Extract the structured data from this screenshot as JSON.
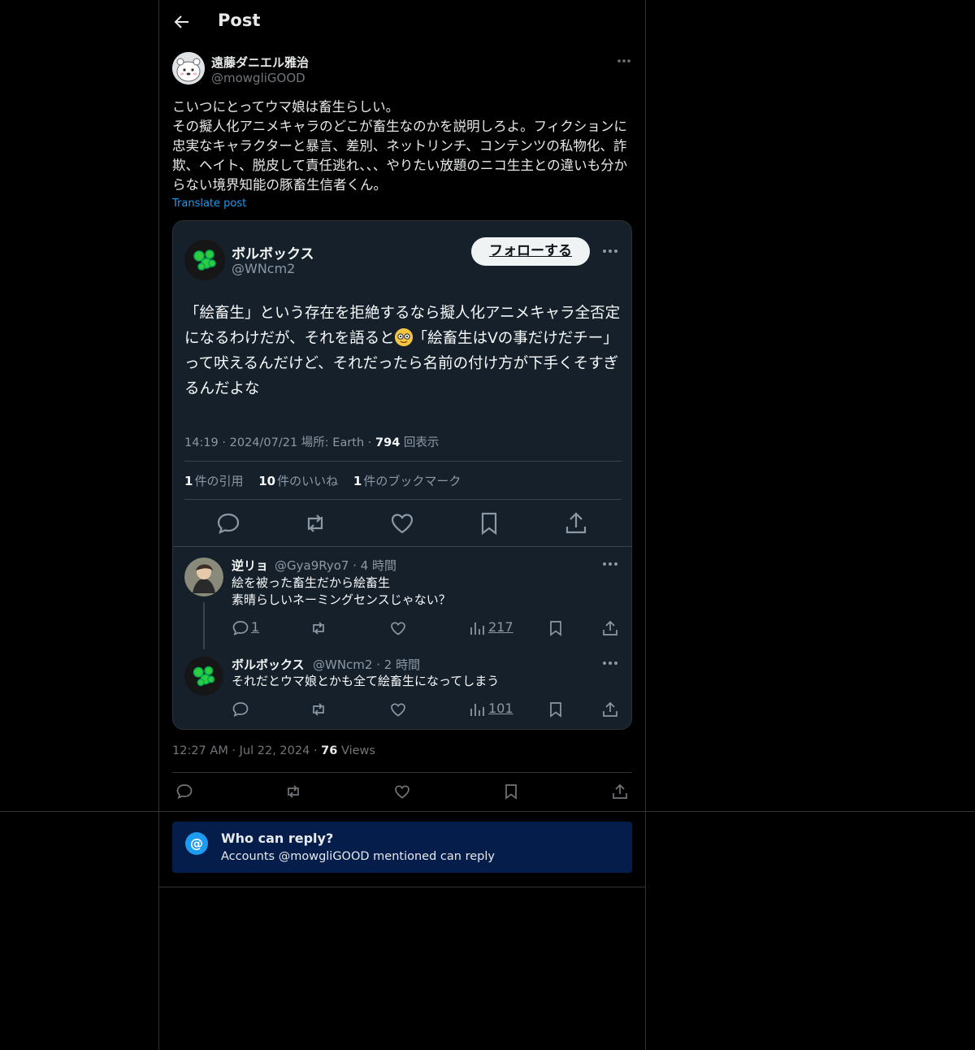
{
  "header": {
    "title": "Post",
    "back_icon": "arrow-left-icon"
  },
  "author": {
    "name": "遠藤ダニエル雅治",
    "handle": "@mowgliGOOD"
  },
  "post": {
    "text": "こいつにとってウマ娘は畜生らしい。\nその擬人化アニメキャラのどこが畜生なのかを説明しろよ。フィクションに忠実なキャラクターと暴言、差別、ネットリンチ、コンテンツの私物化、詐欺、ヘイト、脱皮して責任逃れ、、、やりたい放題のニコ生主との違いも分からない境界知能の豚畜生信者くん。",
    "translate_label": "Translate post",
    "time": "12:27 AM",
    "date": "Jul 22, 2024",
    "views_count": "76",
    "views_label": "Views"
  },
  "embed": {
    "name": "ボルボックス",
    "handle": "@WNcm2",
    "follow_label": "フォローする",
    "text_before_emoji": "「絵畜生」という存在を拒絶するなら擬人化アニメキャラ全否定になるわけだが、それを語ると",
    "text_after_emoji": "「絵畜生はVの事だけだチー」って吠えるんだけど、それだったら名前の付け方が下手くそすぎるんだよな",
    "meta": "14:19 · 2024/07/21 場所: Earth · ",
    "meta_views": "794",
    "meta_views_label": " 回表示",
    "quotes_count": "1",
    "quotes_label": "件の引用",
    "likes_count": "10",
    "likes_label": "件のいいね",
    "bookmarks_count": "1",
    "bookmarks_label": "件のブックマーク",
    "replies": [
      {
        "name": "逆リョ",
        "meta": "@Gya9Ryo7 · 4 時間",
        "text": "絵を被った畜生だから絵畜生\n素晴らしいネーミングセンスじゃない？",
        "reply_count": "1",
        "views": "217"
      },
      {
        "name": "ボルボックス",
        "meta": "@WNcm2 · 2 時間",
        "text": "それだとウマ娘とかも全て絵畜生になってしまう",
        "views": "101"
      }
    ]
  },
  "reply_restriction": {
    "title": "Who can reply?",
    "subtitle": "Accounts @mowgliGOOD mentioned can reply",
    "icon_text": "@"
  },
  "colors": {
    "accent": "#1d9bf0",
    "background": "#000000",
    "embed_bg": "#15202b",
    "who_box": "#051d4b"
  }
}
